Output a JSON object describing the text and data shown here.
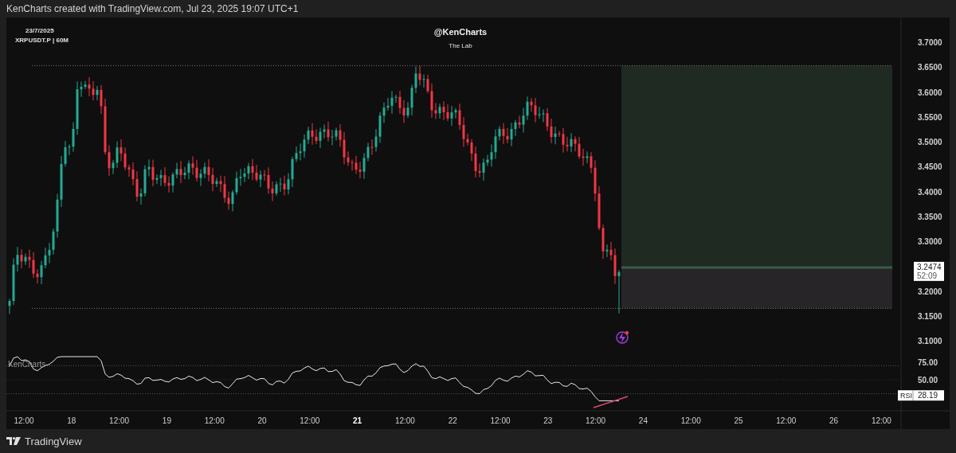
{
  "header": {
    "text": "KenCharts created with TradingView.com, Jul 23, 2025 19:07 UTC+1"
  },
  "legend": {
    "date": "23/7/2025",
    "symbol": "XRPUSDT.P | 60M"
  },
  "title": {
    "author": "@KenCharts",
    "subtitle": "The Lab"
  },
  "price_axis": {
    "labels": [
      "3.7000",
      "3.6500",
      "3.6000",
      "3.5500",
      "3.5000",
      "3.4500",
      "3.4000",
      "3.3500",
      "3.3000",
      "3.2000",
      "3.1500",
      "3.1000"
    ],
    "last_price": "3.2474",
    "countdown": "52:09"
  },
  "rsi_pane": {
    "watermark": "KenCharts",
    "axis_labels": [
      "75.00",
      "50.00"
    ],
    "indicator_label": "RSI",
    "value": "28.19"
  },
  "time_axis": {
    "labels": [
      {
        "text": "12:00",
        "bold": false
      },
      {
        "text": "18",
        "bold": false
      },
      {
        "text": "12:00",
        "bold": false
      },
      {
        "text": "19",
        "bold": false
      },
      {
        "text": "12:00",
        "bold": false
      },
      {
        "text": "20",
        "bold": false
      },
      {
        "text": "12:00",
        "bold": false
      },
      {
        "text": "21",
        "bold": true
      },
      {
        "text": "12:00",
        "bold": false
      },
      {
        "text": "22",
        "bold": false
      },
      {
        "text": "12:00",
        "bold": false
      },
      {
        "text": "23",
        "bold": false
      },
      {
        "text": "12:00",
        "bold": false
      },
      {
        "text": "24",
        "bold": false
      },
      {
        "text": "12:00",
        "bold": false
      },
      {
        "text": "25",
        "bold": false
      },
      {
        "text": "12:00",
        "bold": false
      },
      {
        "text": "26",
        "bold": false
      },
      {
        "text": "12:00",
        "bold": false
      }
    ]
  },
  "footer": {
    "brand": "TradingView"
  }
}
